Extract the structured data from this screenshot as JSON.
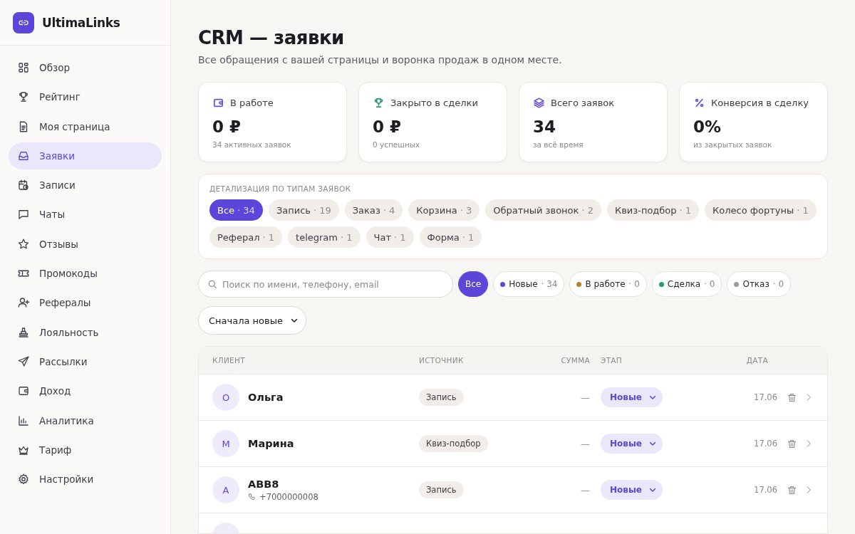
{
  "sidebar": {
    "brand": "UltimaLinks",
    "items": [
      {
        "label": "Обзор",
        "selected": false
      },
      {
        "label": "Рейтинг",
        "selected": false
      },
      {
        "label": "Моя страница",
        "selected": false
      },
      {
        "label": "Заявки",
        "selected": true
      },
      {
        "label": "Записи",
        "selected": false
      },
      {
        "label": "Чаты",
        "selected": false
      },
      {
        "label": "Отзывы",
        "selected": false
      },
      {
        "label": "Промокоды",
        "selected": false
      },
      {
        "label": "Рефералы",
        "selected": false
      },
      {
        "label": "Лояльность",
        "selected": false
      },
      {
        "label": "Рассылки",
        "selected": false
      },
      {
        "label": "Доход",
        "selected": false
      },
      {
        "label": "Аналитика",
        "selected": false
      },
      {
        "label": "Тариф",
        "selected": false
      },
      {
        "label": "Настройки",
        "selected": false
      }
    ]
  },
  "header": {
    "title": "CRM — заявки",
    "subtitle": "Все обращения с вашей страницы и воронка продаж в одном месте."
  },
  "stats": [
    {
      "label": "В работе",
      "value": "0 ₽",
      "note": "34 активных заявок",
      "color": "#6a4fe0"
    },
    {
      "label": "Закрыто в сделки",
      "value": "0 ₽",
      "note": "0 успешных",
      "color": "#2f9a6f"
    },
    {
      "label": "Всего заявок",
      "value": "34",
      "note": "за всё время",
      "color": "#6a4fe0"
    },
    {
      "label": "Конверсия в сделку",
      "value": "0%",
      "note": "из закрытых заявок",
      "color": "#6a4fe0"
    }
  ],
  "breakdown": {
    "title": "ДЕТАЛИЗАЦИЯ ПО ТИПАМ ЗАЯВОК",
    "chips": [
      {
        "label": "Все",
        "count": "· 34",
        "selected": true
      },
      {
        "label": "Запись",
        "count": "· 19",
        "selected": false
      },
      {
        "label": "Заказ",
        "count": "· 4",
        "selected": false
      },
      {
        "label": "Корзина",
        "count": "· 3",
        "selected": false
      },
      {
        "label": "Обратный звонок",
        "count": "· 2",
        "selected": false
      },
      {
        "label": "Квиз-подбор",
        "count": "· 1",
        "selected": false
      },
      {
        "label": "Колесо фортуны",
        "count": "· 1",
        "selected": false
      },
      {
        "label": "Реферал",
        "count": "· 1",
        "selected": false
      },
      {
        "label": "telegram",
        "count": "· 1",
        "selected": false
      },
      {
        "label": "Чат",
        "count": "· 1",
        "selected": false
      },
      {
        "label": "Форма",
        "count": "· 1",
        "selected": false
      }
    ]
  },
  "search": {
    "placeholder": "Поиск по имени, телефону, email"
  },
  "stage_filters": [
    {
      "label": "Все",
      "selected": true
    },
    {
      "label": "Новые",
      "count": "· 34",
      "color": "#5b4ad8",
      "selected": false
    },
    {
      "label": "В работе",
      "count": "· 0",
      "color": "#b0862a",
      "selected": false
    },
    {
      "label": "Сделка",
      "count": "· 0",
      "color": "#2f9a6f",
      "selected": false
    },
    {
      "label": "Отказ",
      "count": "· 0",
      "color": "#9a9aa2",
      "selected": false
    }
  ],
  "sort": {
    "value": "Сначала новые"
  },
  "table": {
    "columns": [
      "КЛИЕНТ",
      "ИСТОЧНИК",
      "СУММА",
      "ЭТАП",
      "ДАТА"
    ],
    "rows": [
      {
        "initial": "О",
        "name": "Ольга",
        "source": "Запись",
        "amount": "—",
        "stage": "Новые",
        "date": "17.06"
      },
      {
        "initial": "М",
        "name": "Марина",
        "source": "Квиз-подбор",
        "amount": "—",
        "stage": "Новые",
        "date": "17.06"
      },
      {
        "initial": "А",
        "name": "ABB8",
        "phone": "+7000000008",
        "source": "Запись",
        "amount": "—",
        "stage": "Новые",
        "date": "17.06"
      }
    ]
  }
}
